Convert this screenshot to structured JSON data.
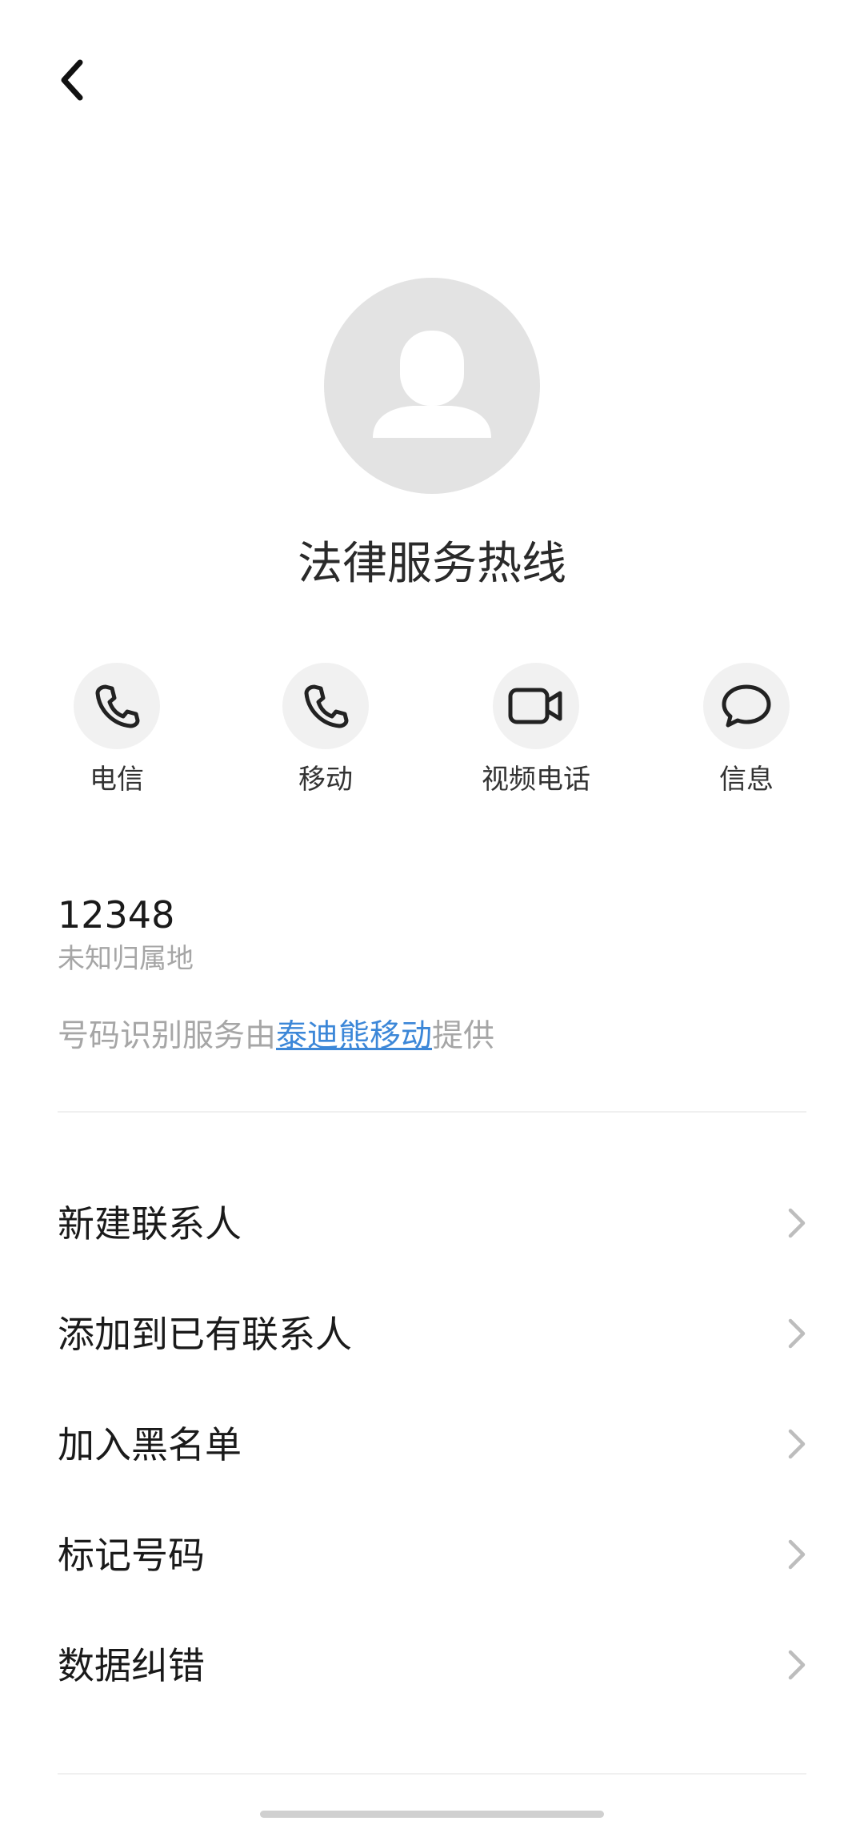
{
  "header": {
    "back_icon": "chevron-left-icon"
  },
  "contact": {
    "avatar_icon": "person-icon",
    "name": "法律服务热线",
    "number": "12348",
    "location": "未知归属地"
  },
  "actions": [
    {
      "label": "电信",
      "icon": "phone-icon"
    },
    {
      "label": "移动",
      "icon": "phone-icon"
    },
    {
      "label": "视频电话",
      "icon": "video-camera-icon"
    },
    {
      "label": "信息",
      "icon": "message-bubble-icon"
    }
  ],
  "provider": {
    "prefix": "号码识别服务由",
    "link": "泰迪熊移动",
    "suffix": "提供"
  },
  "menu": [
    {
      "label": "新建联系人"
    },
    {
      "label": "添加到已有联系人"
    },
    {
      "label": "加入黑名单"
    },
    {
      "label": "标记号码"
    },
    {
      "label": "数据纠错"
    }
  ],
  "colors": {
    "link": "#3c87d8",
    "secondary_text": "#a6a6a6",
    "avatar_bg": "#e3e3e3",
    "action_bg": "#f1f1f1"
  }
}
